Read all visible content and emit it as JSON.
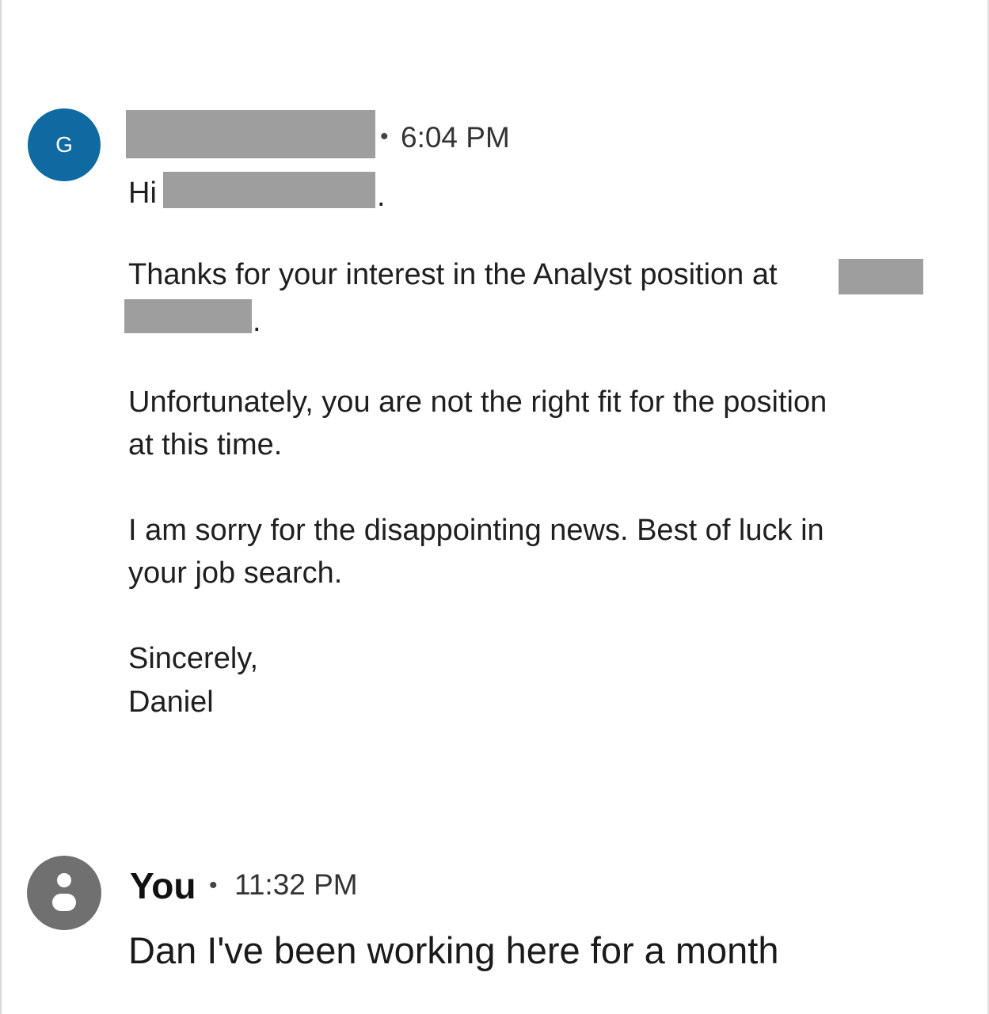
{
  "message": {
    "sender_initial": "G",
    "separator": "•",
    "time": "6:04 PM",
    "greeting": "Hi",
    "greeting_end": ".",
    "line1": "Thanks for your interest in the Analyst position at",
    "line1_end": ".",
    "para2_line1": "Unfortunately, you are not the right fit for the position",
    "para2_line2": "at this time.",
    "para3_line1": "I am sorry for the disappointing news. Best of luck in",
    "para3_line2": "your job search.",
    "signoff": "Sincerely,",
    "signature": "Daniel"
  },
  "reply": {
    "sender": "You",
    "separator": "•",
    "time": "11:32 PM",
    "text": "Dan I've been working here for a month"
  },
  "colors": {
    "avatar_sender": "#0f6aa1",
    "avatar_you": "#707070",
    "redaction": "#9e9e9e"
  },
  "icons": {
    "you_avatar": "default-person-icon"
  }
}
